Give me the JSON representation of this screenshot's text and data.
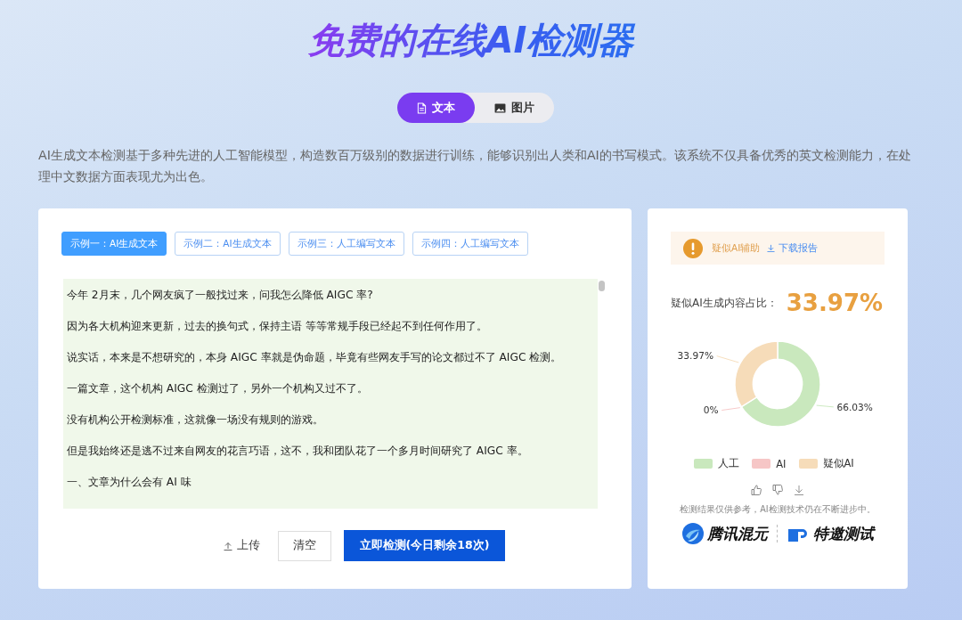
{
  "title": "免费的在线AI检测器",
  "tabs": [
    {
      "label": "文本",
      "selected": true,
      "kind": "text"
    },
    {
      "label": "图片",
      "selected": false,
      "kind": "image"
    }
  ],
  "description": "AI生成文本检测基于多种先进的人工智能模型，构造数百万级别的数据进行训练，能够识别出人类和AI的书写模式。该系统不仅具备优秀的英文检测能力，在处理中文数据方面表现尤为出色。",
  "examples": [
    {
      "label": "示例一：AI生成文本",
      "selected": true
    },
    {
      "label": "示例二：AI生成文本",
      "selected": false
    },
    {
      "label": "示例三：人工编写文本",
      "selected": false
    },
    {
      "label": "示例四：人工编写文本",
      "selected": false
    }
  ],
  "editor_lines": [
    "今年 2月末，几个网友疯了一般找过来，问我怎么降低 AIGC 率?",
    "因为各大机构迎来更新，过去的换句式，保持主语 等等常规手段已经起不到任何作用了。",
    "说实话，本来是不想研究的，本身 AIGC 率就是伪命题，毕竟有些网友手写的论文都过不了 AIGC 检测。",
    " 一篇文章，这个机构 AIGC 检测过了，另外一个机构又过不了。",
    "没有机构公开检测标准，这就像一场没有规则的游戏。",
    "但是我始终还是逃不过来自网友的花言巧语，这不，我和团队花了一个多月时间研究了 AIGC 率。",
    "一、文章为什么会有 AI 味"
  ],
  "actions": {
    "upload": "上传",
    "clear": "清空",
    "detect": "立即检测(今日剩余18次)"
  },
  "result": {
    "verdict": "疑似AI辅助",
    "download": "下载报告",
    "ratio_label": "疑似AI生成内容占比：",
    "ratio": "33.97%",
    "chart_data": {
      "type": "donut",
      "categories": [
        "人工",
        "AI",
        "疑似AI"
      ],
      "series": [
        {
          "values": [
            66.03,
            0,
            33.97
          ]
        }
      ],
      "colors": [
        "#c9e8bd",
        "#f6c6c6",
        "#f6dcb9"
      ],
      "value_labels": [
        "66.03%",
        "0%",
        "33.97%"
      ]
    },
    "disclaimer": "检测结果仅供参考，AI检测技术仍在不断进步中。",
    "brand": "腾讯混元",
    "badge": "特邀测试"
  }
}
